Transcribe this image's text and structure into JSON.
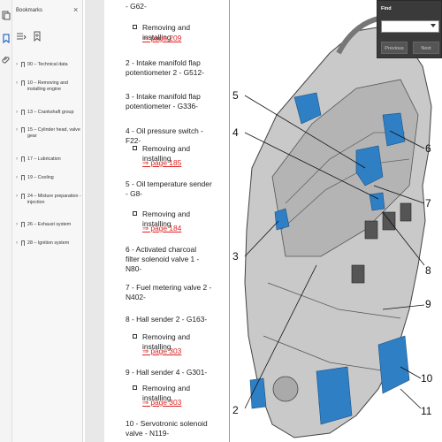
{
  "sidebar": {
    "header": "Bookmarks",
    "close_glyph": "×",
    "items": [
      {
        "label": "00 – Technical data"
      },
      {
        "label": "10 – Removing and installing engine"
      },
      {
        "label": "13 – Crankshaft group"
      },
      {
        "label": "15 – Cylinder head, valve gear"
      },
      {
        "label": "17 – Lubrication"
      },
      {
        "label": "19 – Cooling"
      },
      {
        "label": "24 – Mixture preparation - injection"
      },
      {
        "label": "26 – Exhaust system"
      },
      {
        "label": "28 – Ignition system"
      }
    ]
  },
  "document": {
    "entries": [
      {
        "heading": "- G62-",
        "action": "Removing and installing",
        "link": "⇒ page 209"
      },
      {
        "heading": "2 - Intake manifold flap potentiometer 2 - G512-"
      },
      {
        "heading": "3 - Intake manifold flap potentiometer - G336-"
      },
      {
        "heading": "4 - Oil pressure switch - F22-",
        "action": "Removing and installing",
        "link": "⇒ page 185"
      },
      {
        "heading": "5 - Oil temperature sender - G8-",
        "action": "Removing and installing",
        "link": "⇒ page 184"
      },
      {
        "heading": "6 - Activated charcoal filter solenoid valve 1 - N80-"
      },
      {
        "heading": "7 - Fuel metering valve 2 - N402-"
      },
      {
        "heading": "8 - Hall sender 2 - G163-",
        "action": "Removing and installing",
        "link": "⇒ page 303"
      },
      {
        "heading": "9 - Hall sender 4 - G301-",
        "action": "Removing and installing",
        "link": "⇒ page 303"
      },
      {
        "heading": "10 - Servotronic solenoid valve - N119-"
      }
    ],
    "callouts": [
      "2",
      "3",
      "4",
      "5",
      "6",
      "7",
      "8",
      "9",
      "10",
      "11"
    ]
  },
  "find": {
    "title": "Find",
    "previous": "Previous",
    "next": "Next"
  }
}
